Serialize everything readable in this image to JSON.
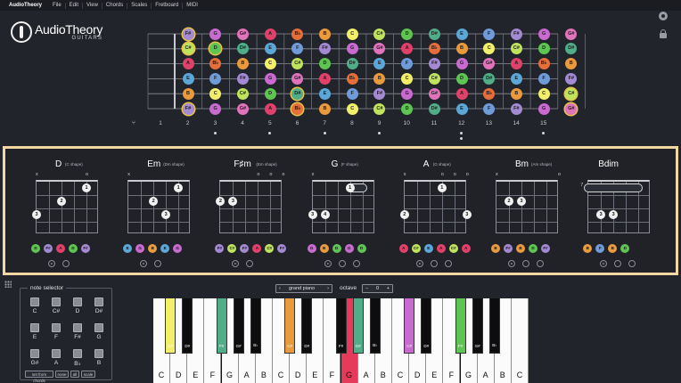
{
  "menubar": {
    "app_name": "AudioTheory",
    "items": [
      "File",
      "Edit",
      "View",
      "Chords",
      "Scales",
      "Fretboard",
      "MIDI"
    ]
  },
  "logo": {
    "name": "AudioTheory",
    "subtitle": "GUITARS"
  },
  "icons": {
    "settings": "gear-icon",
    "lock": "lock-icon"
  },
  "fretboard": {
    "tuning_icon": "tuning-fork-icon",
    "fret_numbers": [
      "1",
      "2",
      "3",
      "4",
      "5",
      "6",
      "7",
      "8",
      "9",
      "10",
      "11",
      "12",
      "13",
      "14",
      "15"
    ],
    "single_markers": [
      3,
      5,
      7,
      9,
      15
    ],
    "double_markers": [
      12
    ],
    "strings": [
      {
        "open": "F#",
        "ringed": true,
        "notes": [
          "G",
          "G#",
          "A",
          "B♭",
          "B",
          "C",
          "C#",
          "D",
          "D#",
          "E",
          "F",
          "F#",
          "G",
          "G#"
        ]
      },
      {
        "open": "C#",
        "ringed": true,
        "notes": [
          "D",
          "D#",
          "E",
          "F",
          "F#",
          "G",
          "G#",
          "A",
          "B♭",
          "B",
          "C",
          "C#",
          "D",
          "D#"
        ]
      },
      {
        "open": "A",
        "ringed": false,
        "notes": [
          "B♭",
          "B",
          "C",
          "C#",
          "D",
          "D#",
          "E",
          "F",
          "F#",
          "G",
          "G#",
          "A",
          "B♭",
          "B"
        ]
      },
      {
        "open": "E",
        "ringed": false,
        "notes": [
          "F",
          "F#",
          "G",
          "G#",
          "A",
          "B♭",
          "B",
          "C",
          "C#",
          "D",
          "D#",
          "E",
          "F",
          "F#"
        ]
      },
      {
        "open": "B",
        "ringed": false,
        "notes": [
          "C",
          "C#",
          "D",
          "D#",
          "E",
          "F",
          "F#",
          "G",
          "G#",
          "A",
          "B♭",
          "B",
          "C",
          "C#"
        ]
      },
      {
        "open": "F#",
        "ringed": true,
        "notes": [
          "G",
          "G#",
          "A",
          "B♭",
          "B",
          "C",
          "C#",
          "D",
          "D#",
          "E",
          "F",
          "F#",
          "G",
          "G#"
        ]
      }
    ],
    "ringed_cells": [
      [
        1,
        1
      ],
      [
        4,
        4
      ],
      [
        4,
        14
      ],
      [
        5,
        14
      ],
      [
        5,
        4
      ]
    ]
  },
  "note_colors": {
    "C": "#f2ef6a",
    "C#": "#bfe35d",
    "D": "#5ec452",
    "D#": "#4fae88",
    "E": "#5aa7d8",
    "F": "#6f9bd8",
    "F#": "#a48ad2",
    "G": "#c96ad0",
    "G#": "#e073ba",
    "A": "#e0416a",
    "B♭": "#e56e39",
    "B": "#e89a3d"
  },
  "chords": [
    {
      "name": "D",
      "shape": "(C shape)",
      "marks": [
        "x",
        "",
        "",
        "",
        "o",
        ""
      ],
      "notes": [
        "D",
        "F#",
        "A",
        "D",
        "F#"
      ],
      "fingers": [
        [
          5,
          1,
          "1"
        ],
        [
          3,
          2,
          "2"
        ],
        [
          1,
          3,
          "3"
        ]
      ],
      "barre": null,
      "fret_label": ""
    },
    {
      "name": "Em",
      "shape": "(Dm shape)",
      "marks": [
        "x",
        "",
        "",
        "",
        "",
        ""
      ],
      "notes": [
        "E",
        "G",
        "B",
        "E",
        "G"
      ],
      "fingers": [
        [
          5,
          1,
          "1"
        ],
        [
          3,
          2,
          "2"
        ],
        [
          4,
          3,
          "3"
        ]
      ],
      "barre": null,
      "fret_label": ""
    },
    {
      "name": "F♯m",
      "shape": "(Em shape)",
      "marks": [
        "",
        "",
        "",
        "o",
        "o",
        "o"
      ],
      "notes": [
        "F#",
        "C#",
        "F#",
        "A",
        "C#",
        "F#"
      ],
      "fingers": [
        [
          1,
          2,
          "2"
        ],
        [
          2,
          2,
          "3"
        ]
      ],
      "barre": null,
      "fret_label": ""
    },
    {
      "name": "G",
      "shape": "(F shape)",
      "marks": [
        "x",
        "",
        "",
        "",
        "",
        ""
      ],
      "notes": [
        "G",
        "B",
        "D",
        "G",
        "D"
      ],
      "fingers": [
        [
          4,
          1,
          "1"
        ],
        [
          1,
          3,
          "3"
        ],
        [
          2,
          3,
          "4"
        ]
      ],
      "barre": [
        4,
        5,
        1
      ],
      "fret_label": ""
    },
    {
      "name": "A",
      "shape": "(G shape)",
      "marks": [
        "x",
        "",
        "",
        "o",
        "o",
        "o"
      ],
      "notes": [
        "A",
        "C#",
        "E",
        "A",
        "C#",
        "A"
      ],
      "fingers": [
        [
          4,
          1,
          "1"
        ],
        [
          1,
          3,
          "2"
        ],
        [
          6,
          3,
          "3"
        ]
      ],
      "barre": null,
      "fret_label": ""
    },
    {
      "name": "Bm",
      "shape": "(Am shape)",
      "marks": [
        "x",
        "",
        "",
        "",
        "",
        "o"
      ],
      "notes": [
        "B",
        "F#",
        "B",
        "D",
        "F#"
      ],
      "fingers": [
        [
          2,
          2,
          "2"
        ],
        [
          3,
          2,
          "3"
        ]
      ],
      "barre": null,
      "fret_label": ""
    },
    {
      "name": "Bdim",
      "shape": "",
      "marks": [
        "",
        "",
        "",
        "",
        "",
        ""
      ],
      "notes": [
        "B",
        "F",
        "B",
        "D"
      ],
      "fingers": [
        [
          2,
          3,
          "3"
        ],
        [
          3,
          3,
          "3"
        ]
      ],
      "barre": [
        1,
        5,
        1
      ],
      "fret_label": "7"
    }
  ],
  "note_selector": {
    "title": "note selector",
    "notes": [
      "C",
      "C#",
      "D",
      "D#",
      "E",
      "F",
      "F#",
      "G",
      "G#",
      "A",
      "B♭",
      "B"
    ],
    "buttons": [
      "set from chords",
      "none",
      "all",
      "scale"
    ]
  },
  "instrument": {
    "value": "grand piano",
    "prev": "‹",
    "next": "›"
  },
  "octave": {
    "label": "octave",
    "value": "0",
    "dec": "−",
    "inc": "+"
  },
  "piano": {
    "white_keys": [
      "C",
      "D",
      "E",
      "F",
      "G",
      "A",
      "B",
      "C",
      "D",
      "E",
      "F",
      "G",
      "A",
      "B",
      "C",
      "D",
      "E",
      "F",
      "G",
      "A",
      "B",
      "C"
    ],
    "black_keys": [
      "C#",
      "D#",
      "F#",
      "G#",
      "B♭",
      "C#",
      "D#",
      "F#",
      "G#",
      "B♭",
      "C#",
      "D#",
      "F#",
      "G#",
      "B♭"
    ],
    "highlight_white": {
      "11": "#e63a5a"
    },
    "highlight_black": {
      "0": "#f2ef6a",
      "2": "#4fae88",
      "5": "#e89a3d",
      "8": "#4fae88",
      "10": "#c96ad0",
      "12": "#5ec452"
    }
  }
}
